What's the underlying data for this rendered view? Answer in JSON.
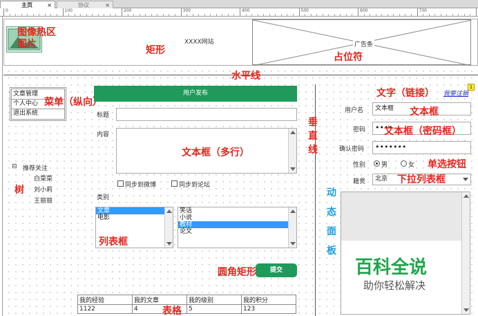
{
  "tabs": [
    {
      "label": "主页",
      "close": "×"
    },
    {
      "label": "协议",
      "close": "×"
    }
  ],
  "ruler": {
    "ticks": [
      "0",
      "100",
      "200",
      "300",
      "400",
      "500",
      "600",
      "700",
      "800"
    ]
  },
  "header": {
    "image_hotspot_label": "图像热区",
    "image_label": "图片",
    "rect_label": "矩形",
    "site_name": "XXXX网站",
    "ad_text": "广告条",
    "placeholder_label": "占位符",
    "hr_label": "水平线"
  },
  "menu": {
    "items": [
      "文章管理",
      "个人中心",
      "退出系统"
    ],
    "label": "菜单（纵向）"
  },
  "tree": {
    "toggle": "⊟",
    "root": "推荐关注",
    "children": [
      "白菜菜",
      "刘小莉",
      "王丽丽"
    ],
    "label": "树"
  },
  "form": {
    "header": "用户发布",
    "title_label": "标题",
    "content_label": "内容",
    "textarea_label": "文本框（多行）",
    "sync_weibo": "同步到微博",
    "sync_forum": "同步到论坛",
    "category_label": "类别",
    "list1": [
      "文章",
      "电影"
    ],
    "list2": [
      "笑话",
      "小说",
      "教材",
      "论文"
    ],
    "listbox_label": "列表框",
    "submit": "提交",
    "round_rect_label": "圆角矩形"
  },
  "vline_label": [
    "垂",
    "直",
    "线"
  ],
  "table": {
    "headers": [
      "我的经验",
      "我的文章",
      "我的级别",
      "我的积分"
    ],
    "values": [
      "1122",
      "4",
      "5",
      "123"
    ],
    "label": "表格"
  },
  "right": {
    "text_link_label": "文字（链接）",
    "logout_link": "我要注销",
    "username_label": "用户名",
    "username_value": "文本框",
    "textbox_label": "文本框",
    "password_label": "密码",
    "password_value": "••••",
    "password_box_label": "文本框（密码框）",
    "confirm_label": "确认密码",
    "confirm_value": "•••••••",
    "gender_label": "性别",
    "male": "男",
    "female": "女",
    "radio_label": "单选按钮",
    "native_label": "籍贯",
    "native_value": "北京",
    "dropdown_label": "下拉列表框",
    "dynamic_panel_label": [
      "动",
      "态",
      "面",
      "板"
    ],
    "panel_title": "百科全说",
    "panel_subtitle": "助你轻松解决",
    "note_marker": "1"
  },
  "colors": {
    "accent_green": "#1f9a5a",
    "red_label": "#e5261f",
    "blue_label": "#1ea0dc",
    "selection": "#3399ff"
  }
}
